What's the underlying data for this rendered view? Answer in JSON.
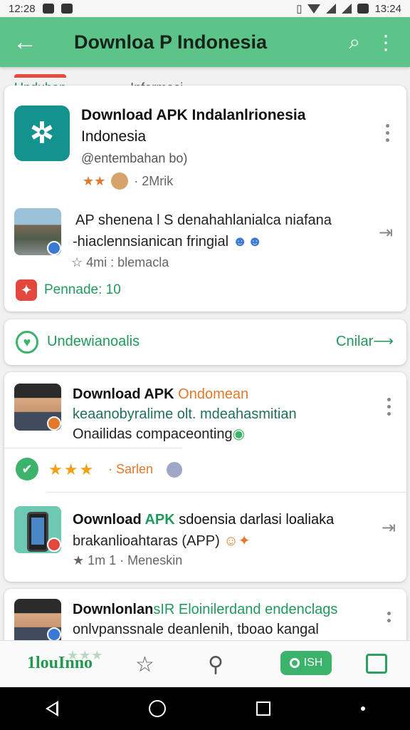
{
  "status_bar": {
    "time_left": "12:28",
    "time_right": "13:24"
  },
  "app_bar": {
    "title": "Downloa  P Indonesia",
    "back_icon": "arrow-left-icon",
    "search_icon": "search-icon",
    "menu_icon": "kebab-menu-icon"
  },
  "tabs": [
    "Unduhan",
    "Informasi"
  ],
  "featured": {
    "title_line1": "Download APK Indalanlrionesia",
    "title_line2": "Indonesia",
    "subtitle": "@entembahan bo)",
    "meta": "· 2Mrik",
    "item": {
      "line1": "AP shenena l S denahahlanialca niafana",
      "line2": "-hiaclennsianican fringial",
      "meta": "4mi : blemacla"
    },
    "pennade": "Pennade: 10"
  },
  "section_bar": {
    "label": "Undewianoalis",
    "action": "Cnilar"
  },
  "list": [
    {
      "title_a": "Download APK ",
      "title_b": "Ondomean",
      "line2": "keaanobyralime olt. mdeahasmitian",
      "line3": "Onailidas compaceonting",
      "rating_meta": "· Sarlen"
    },
    {
      "title_a": "Oownload ",
      "title_b": "APK",
      "title_c": " sdoensia darlasi loaliaka",
      "line2": "brakanlioahtaras (APP)",
      "meta": "1m 1 · Meneskin"
    },
    {
      "title_a": "Downlonlan",
      "title_b": "sIR Eloinilerdand endenclags",
      "line2": "onlvpanssnale deanlenih, tboao kangal"
    }
  ],
  "bottom_nav": {
    "brand": "1louInno",
    "pill_label": "ISH"
  },
  "colors": {
    "accent": "#5cc489",
    "brand_green": "#23984f",
    "orange": "#e3772a",
    "red": "#e2483c",
    "teal": "#14928d"
  }
}
